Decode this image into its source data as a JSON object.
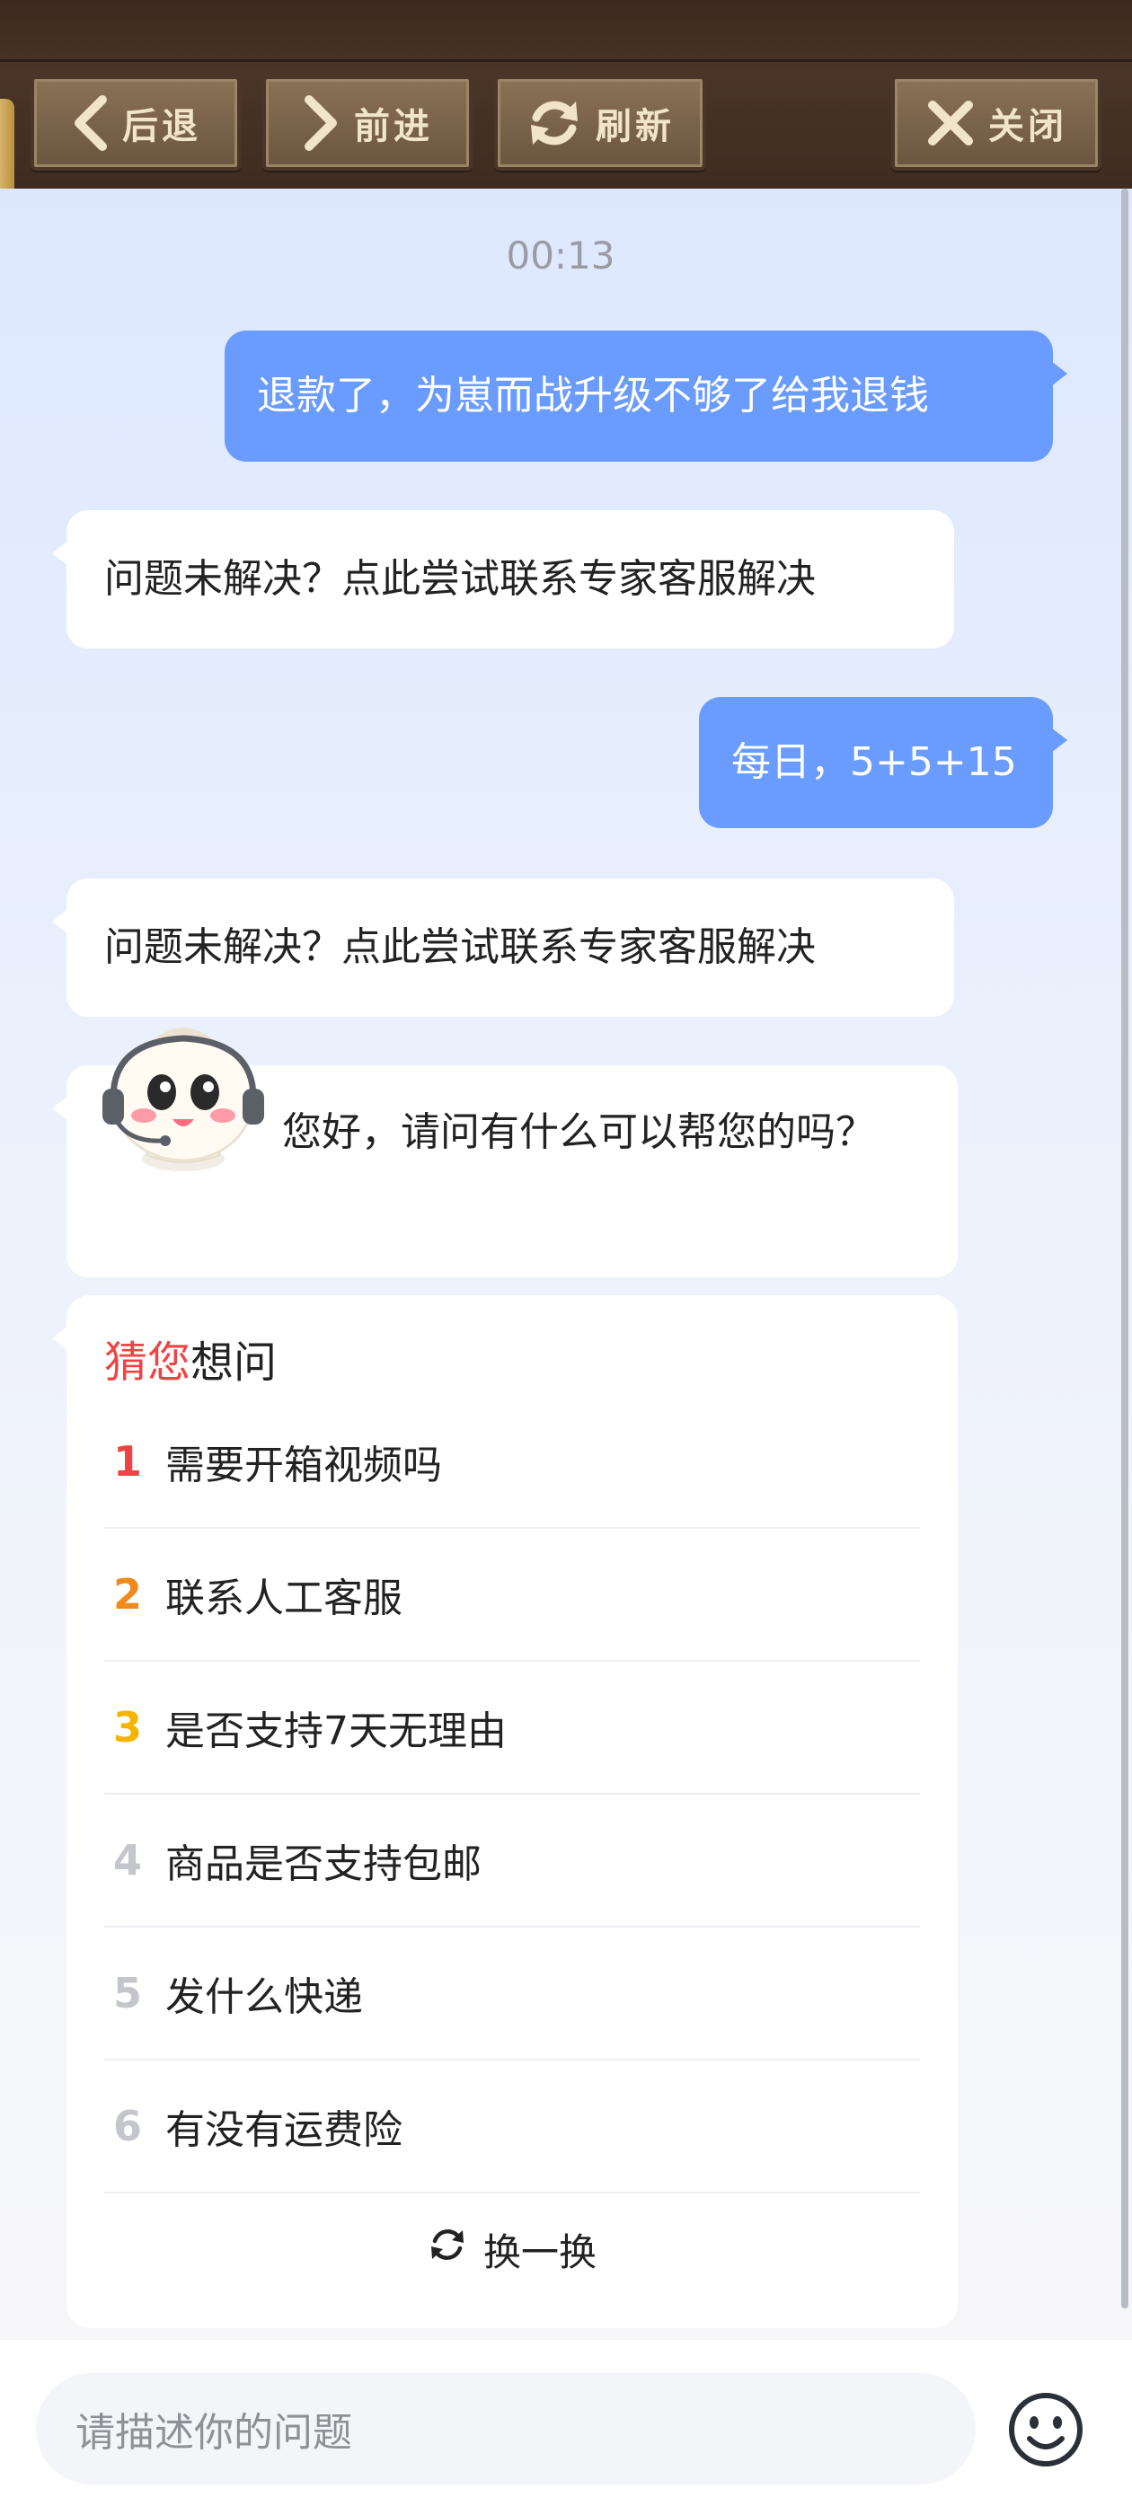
{
  "toolbar": {
    "back_label": "后退",
    "forward_label": "前进",
    "refresh_label": "刷新",
    "close_label": "关闭"
  },
  "chat": {
    "timestamp": "00:13",
    "messages": [
      {
        "role": "user",
        "text": "退款了，为崽而战升级不够了给我退钱"
      },
      {
        "role": "bot",
        "text": "问题未解决？点此尝试联系专家客服解决"
      },
      {
        "role": "user",
        "text": "每日，5+5+15"
      },
      {
        "role": "bot",
        "text": "问题未解决？点此尝试联系专家客服解决"
      }
    ],
    "greeting": "您好，请问有什么可以帮您的吗？"
  },
  "suggestions": {
    "title_highlight": "猜您",
    "title_rest": "想问",
    "items": [
      {
        "num": "1",
        "text": "需要开箱视频吗",
        "color": "#ef4444"
      },
      {
        "num": "2",
        "text": "联系人工客服",
        "color": "#f08a1c"
      },
      {
        "num": "3",
        "text": "是否支持7天无理由",
        "color": "#f5b400"
      },
      {
        "num": "4",
        "text": "商品是否支持包邮",
        "color": "#c4c6cb"
      },
      {
        "num": "5",
        "text": "发什么快递",
        "color": "#c4c6cb"
      },
      {
        "num": "6",
        "text": "有没有运费险",
        "color": "#c4c6cb"
      }
    ],
    "refresh_label": "换一换"
  },
  "input": {
    "placeholder": "请描述你的问题"
  },
  "colors": {
    "user_bubble": "#6a9bff",
    "toolbar_bg": "#3b2a1e",
    "toolbar_button": "#7a6249"
  },
  "icons": [
    "chevron-left-icon",
    "chevron-right-icon",
    "refresh-icon",
    "close-icon",
    "smiley-icon",
    "mascot-avatar"
  ]
}
